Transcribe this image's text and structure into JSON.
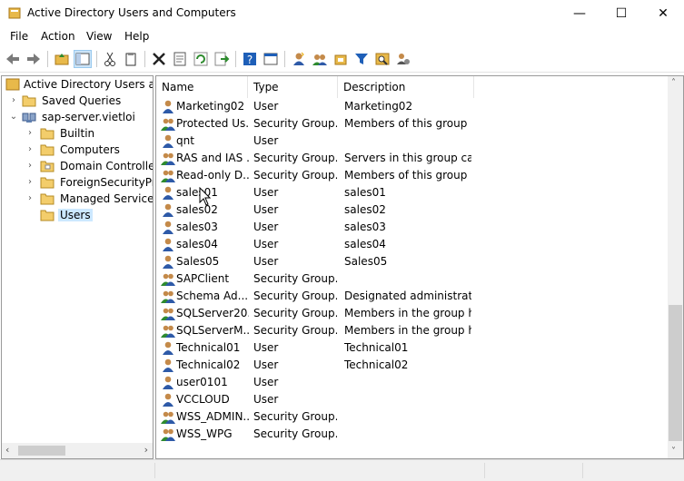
{
  "window": {
    "title": "Active Directory Users and Computers",
    "minimize_glyph": "—",
    "maximize_glyph": "☐",
    "close_glyph": "✕"
  },
  "menu": [
    "File",
    "Action",
    "View",
    "Help"
  ],
  "tree": {
    "root": "Active Directory Users and",
    "items": [
      {
        "label": "Saved Queries",
        "expander": "›"
      },
      {
        "label": "sap-server.vietloi",
        "expander": "⌄"
      },
      {
        "label": "Builtin",
        "expander": "›"
      },
      {
        "label": "Computers",
        "expander": "›"
      },
      {
        "label": "Domain Controller",
        "expander": "›"
      },
      {
        "label": "ForeignSecurityPrir",
        "expander": "›"
      },
      {
        "label": "Managed Service A",
        "expander": "›"
      },
      {
        "label": "Users",
        "expander": ""
      }
    ]
  },
  "columns": {
    "name": "Name",
    "type": "Type",
    "description": "Description"
  },
  "rows": [
    {
      "name": "Marketing02",
      "type": "User",
      "description": "Marketing02",
      "icon": "user-icon"
    },
    {
      "name": "Protected Us...",
      "type": "Security Group...",
      "description": "Members of this group ...",
      "icon": "group-icon"
    },
    {
      "name": "qnt",
      "type": "User",
      "description": "",
      "icon": "user-icon"
    },
    {
      "name": "RAS and IAS ...",
      "type": "Security Group...",
      "description": "Servers in this group can...",
      "icon": "group-icon"
    },
    {
      "name": "Read-only D...",
      "type": "Security Group...",
      "description": "Members of this group ...",
      "icon": "group-icon"
    },
    {
      "name": "sales01",
      "type": "User",
      "description": "sales01",
      "icon": "user-icon"
    },
    {
      "name": "sales02",
      "type": "User",
      "description": "sales02",
      "icon": "user-icon"
    },
    {
      "name": "sales03",
      "type": "User",
      "description": "sales03",
      "icon": "user-icon"
    },
    {
      "name": "sales04",
      "type": "User",
      "description": "sales04",
      "icon": "user-icon"
    },
    {
      "name": "Sales05",
      "type": "User",
      "description": "Sales05",
      "icon": "user-icon"
    },
    {
      "name": "SAPClient",
      "type": "Security Group...",
      "description": "",
      "icon": "group-icon"
    },
    {
      "name": "Schema Ad...",
      "type": "Security Group...",
      "description": "Designated administrato...",
      "icon": "group-icon"
    },
    {
      "name": "SQLServer20...",
      "type": "Security Group...",
      "description": "Members in the group h...",
      "icon": "group-icon"
    },
    {
      "name": "SQLServerM...",
      "type": "Security Group...",
      "description": "Members in the group h...",
      "icon": "group-icon"
    },
    {
      "name": "Technical01",
      "type": "User",
      "description": "Technical01",
      "icon": "user-icon"
    },
    {
      "name": "Technical02",
      "type": "User",
      "description": "Technical02",
      "icon": "user-icon"
    },
    {
      "name": "user0101",
      "type": "User",
      "description": "",
      "icon": "user-icon"
    },
    {
      "name": "VCCLOUD",
      "type": "User",
      "description": "",
      "icon": "user-icon"
    },
    {
      "name": "WSS_ADMIN...",
      "type": "Security Group...",
      "description": "",
      "icon": "group-icon"
    },
    {
      "name": "WSS_WPG",
      "type": "Security Group...",
      "description": "",
      "icon": "group-icon"
    }
  ],
  "colors": {
    "selection": "#cce8ff",
    "folder": "#e8b94a",
    "accent": "#1e5fb8"
  }
}
